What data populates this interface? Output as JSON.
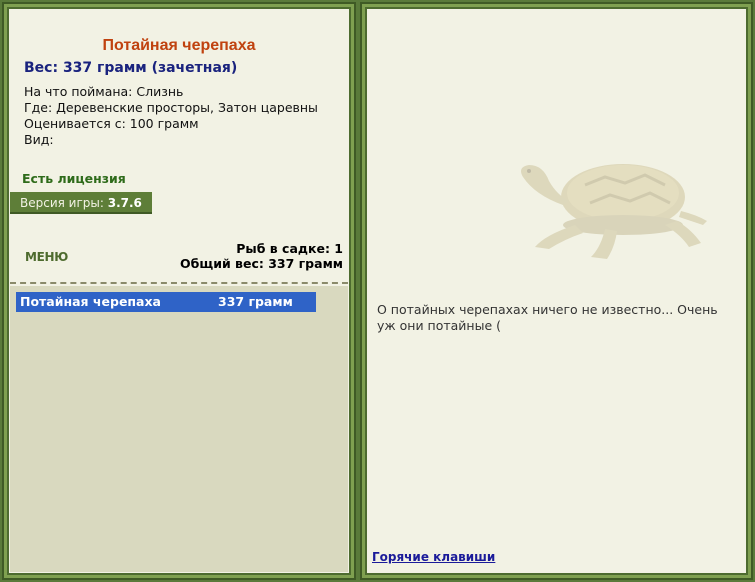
{
  "fish": {
    "name": "Потайная черепаха",
    "weight_line": "Вес: 337 грамм (зачетная)",
    "caught_on": "На что поймана: Слизнь",
    "where": "Где: Деревенские просторы, Затон царевны",
    "valued_from": "Оценивается с: 100 грамм",
    "kind": "Вид:"
  },
  "license": "Есть лицензия",
  "version": {
    "label": "Версия игры:",
    "value": "3.7.6"
  },
  "menu_label": "МЕНЮ",
  "stats": {
    "fish_in_keepnet": "Рыб в садке: 1",
    "total_weight": "Общий вес: 337 грамм"
  },
  "catch_list": [
    {
      "name": "Потайная черепаха",
      "weight": "337 грамм"
    }
  ],
  "description": "О потайных черепахах ничего не известно... Очень уж они потайные (",
  "hotkeys_link": "Горячие клавиши",
  "colors": {
    "selected_row": "#2f63c7",
    "title": "#c0420f",
    "frame": "#5a7a3a"
  },
  "icons": [
    "turtle-image"
  ]
}
